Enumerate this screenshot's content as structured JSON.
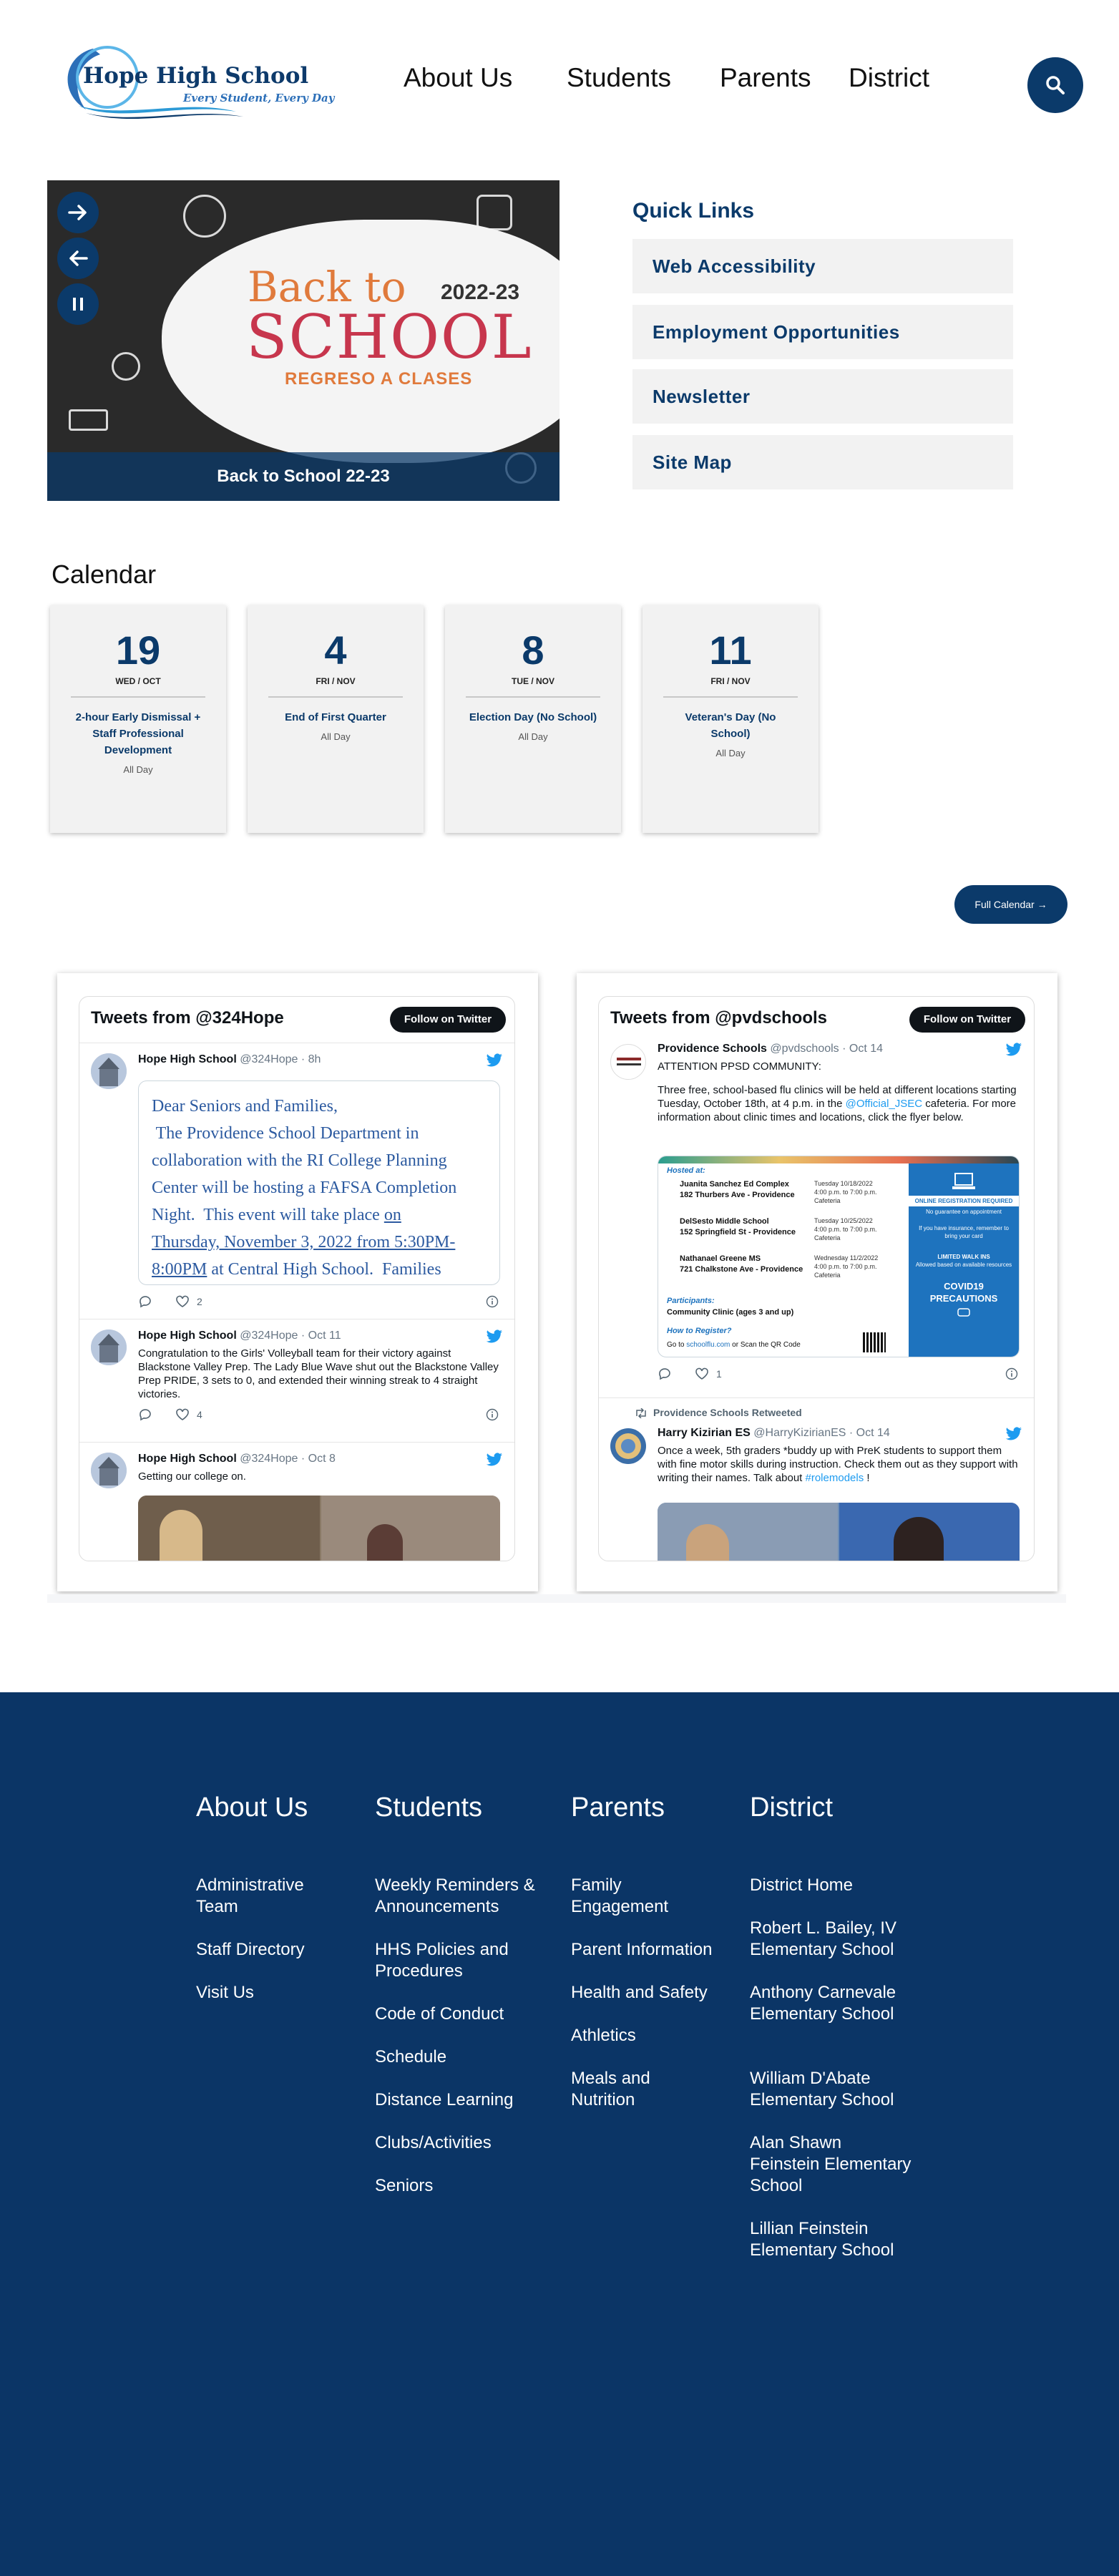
{
  "header": {
    "logo_name": "Hope High School",
    "logo_tagline": "Every Student, Every Day",
    "nav": [
      "About Us",
      "Students",
      "Parents",
      "District"
    ]
  },
  "hero": {
    "back_to": "Back to",
    "school": "SCHOOL",
    "year": "2022-23",
    "subtitle": "REGRESO A CLASES",
    "caption": "Back to School 22-23"
  },
  "quick_links": {
    "title": "Quick Links",
    "items": [
      "Web Accessibility",
      "Employment Opportunities",
      "Newsletter",
      "Site Map"
    ]
  },
  "calendar": {
    "title": "Calendar",
    "events": [
      {
        "day": "19",
        "dow": "WED / OCT",
        "event": "2-hour Early Dismissal + Staff Professional Development",
        "time": "All Day"
      },
      {
        "day": "4",
        "dow": "FRI / NOV",
        "event": "End of First Quarter",
        "time": "All Day"
      },
      {
        "day": "8",
        "dow": "TUE / NOV",
        "event": "Election Day (No School)",
        "time": "All Day"
      },
      {
        "day": "11",
        "dow": "FRI / NOV",
        "event": "Veteran's Day (No School)",
        "time": "All Day"
      }
    ],
    "full_calendar": "Full Calendar →"
  },
  "twitter": {
    "hope": {
      "title": "Tweets from @324Hope",
      "follow": "Follow on Twitter",
      "tweets": [
        {
          "name": "Hope High School",
          "handle": "@324Hope",
          "time": "8h",
          "quote": [
            "Dear Seniors and Families,",
            " The Providence School Department in",
            "collaboration with the RI College Planning",
            "Center will be hosting a FAFSA Completion",
            "Night.  This event will take place ",
            "on",
            "Thursday, November 3, 2022 from 5:30PM-",
            "8:00PM",
            " at Central High School.  Families"
          ],
          "likes": "2"
        },
        {
          "name": "Hope High School",
          "handle": "@324Hope",
          "time": "Oct 11",
          "text": "Congratulation to the Girls' Volleyball team for their victory against Blackstone Valley Prep. The Lady Blue Wave shut out the Blackstone Valley Prep PRIDE, 3 sets to 0, and extended their winning streak to 4 straight victories.",
          "likes": "4"
        },
        {
          "name": "Hope High School",
          "handle": "@324Hope",
          "time": "Oct 8",
          "text": "Getting our college on."
        }
      ]
    },
    "pvd": {
      "title": "Tweets from @pvdschools",
      "follow": "Follow on Twitter",
      "tweets": [
        {
          "name": "Providence Schools",
          "handle": "@pvdschools",
          "time": "Oct 14",
          "text1": "ATTENTION PPSD COMMUNITY:",
          "text2": "Three free, school-based flu clinics will be held at different locations starting Tuesday, October 18th, at 4 p.m. in the ",
          "mention": "@Official_JSEC",
          "text3": " cafeteria. For more information about clinic times and locations, click the flyer below.",
          "likes": "1",
          "flyer": {
            "hosted": "Hosted at:",
            "sites": [
              {
                "name": "Juanita Sanchez Ed Complex",
                "addr": "182 Thurbers Ave - Providence",
                "date": "Tuesday 10/18/2022",
                "time": "4:00 p.m. to 7:00 p.m.",
                "room": "Cafeteria"
              },
              {
                "name": "DelSesto Middle School",
                "addr": "152 Springfield St - Providence",
                "date": "Tuesday 10/25/2022",
                "time": "4:00 p.m. to 7:00 p.m.",
                "room": "Cafeteria"
              },
              {
                "name": "Nathanael Greene MS",
                "addr": "721 Chalkstone Ave - Providence",
                "date": "Wednesday 11/2/2022",
                "time": "4:00 p.m. to 7:00 p.m.",
                "room": "Cafeteria"
              }
            ],
            "participants_label": "Participants:",
            "participants": "Community Clinic (ages 3 and up)",
            "register_label": "How to Register?",
            "register_text": "Go to ",
            "register_link": "schoolflu.com",
            "register_tail": " or Scan the QR Code",
            "side_reg": "ONLINE REGISTRATION REQUIRED",
            "side_reg_sub": "No guarantee on appointment",
            "side_ins": "If you have insurance, remember to bring your card",
            "side_walk": "LIMITED WALK INS",
            "side_walk_sub": "Allowed based on available resources",
            "side_covid": "COVID19",
            "side_prec": "PRECAUTIONS"
          }
        },
        {
          "retweet": "Providence Schools Retweeted",
          "name": "Harry Kizirian ES",
          "handle": "@HarryKizirianES",
          "time": "Oct 14",
          "text": "Once a week, 5th graders *buddy up with PreK students to support them with fine motor skills during instruction. Check them out as they support with writing their names. Talk about ",
          "hashtag": "#rolemodels",
          "tail": " !"
        }
      ]
    }
  },
  "footer": {
    "about": {
      "title": "About Us",
      "links": [
        "Administrative Team",
        "Staff Directory",
        "Visit Us"
      ]
    },
    "students": {
      "title": "Students",
      "links": [
        "Weekly Reminders & Announcements",
        "HHS Policies and Procedures",
        "Code of Conduct",
        "Schedule",
        "Distance Learning",
        "Clubs/Activities",
        "Seniors"
      ]
    },
    "parents": {
      "title": "Parents",
      "links": [
        "Family Engagement",
        "Parent Information",
        "Health and Safety",
        "Athletics",
        "Meals and Nutrition"
      ]
    },
    "district": {
      "title": "District",
      "links": [
        "District Home",
        "Robert L. Bailey, IV Elementary School",
        "Anthony Carnevale Elementary School",
        "William D'Abate Elementary School",
        "Alan Shawn Feinstein Elementary School",
        "Lillian Feinstein Elementary School"
      ]
    }
  },
  "colors": {
    "navy": "#0b3a6a",
    "twitter_blue": "#1d9bf0",
    "quick_link_bg": "#f2f2f2",
    "footer_bg": "#0b3566"
  }
}
